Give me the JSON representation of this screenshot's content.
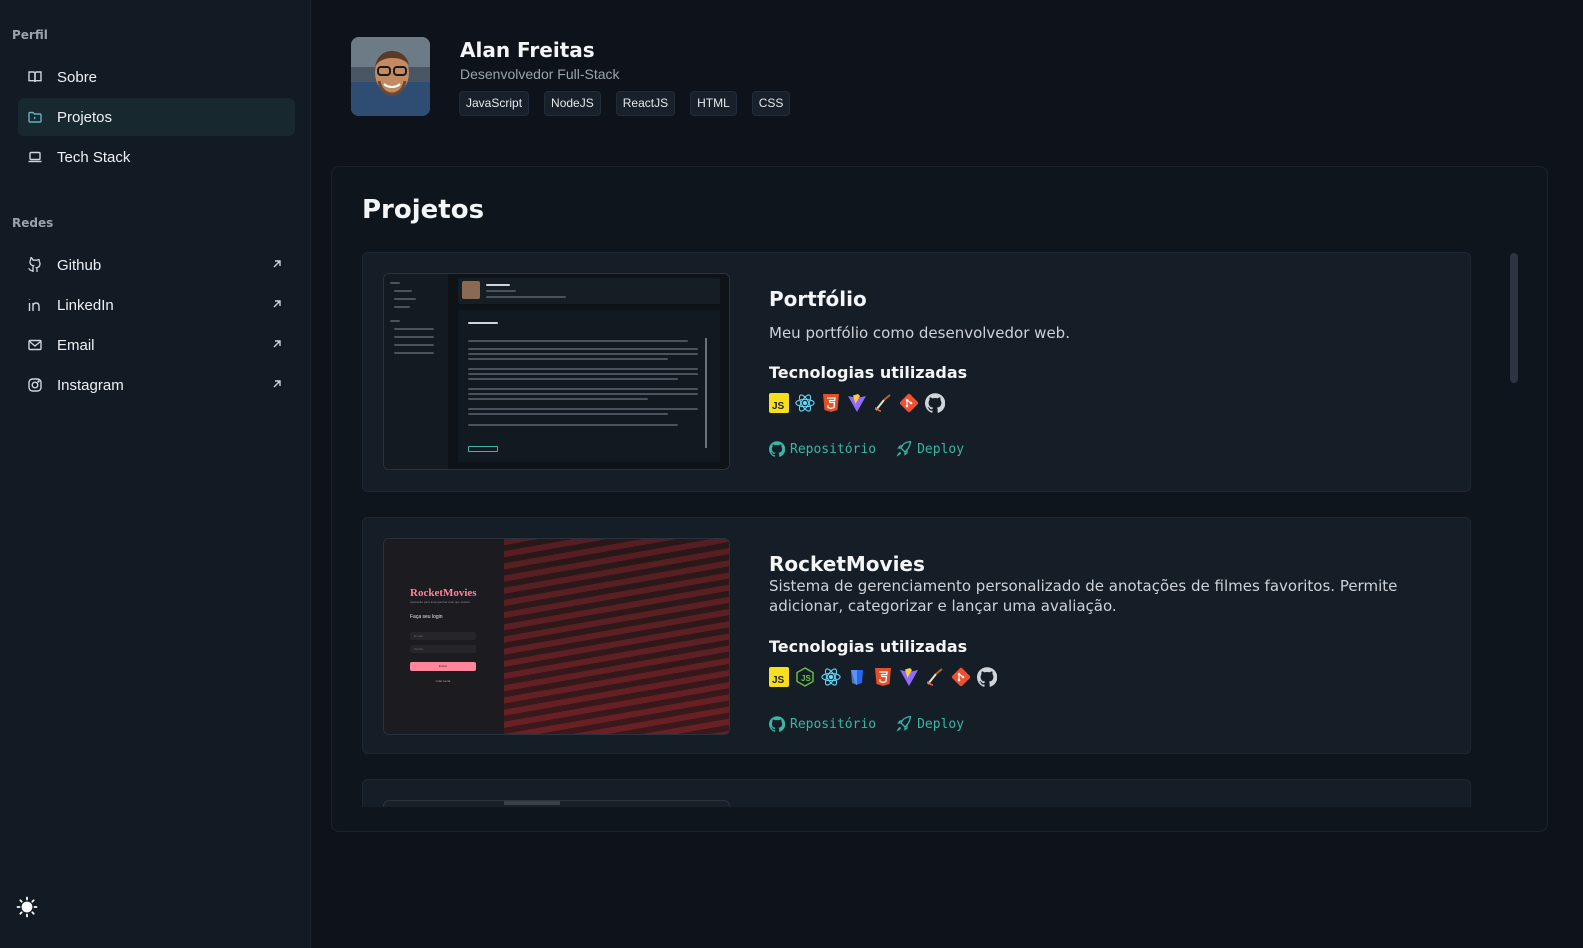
{
  "sidebar": {
    "profile_section": "Perfil",
    "nav": [
      {
        "label": "Sobre",
        "icon": "book-icon"
      },
      {
        "label": "Projetos",
        "icon": "folder-icon",
        "active": true
      },
      {
        "label": "Tech Stack",
        "icon": "laptop-icon"
      }
    ],
    "networks_section": "Redes",
    "networks": [
      {
        "label": "Github",
        "icon": "github-icon"
      },
      {
        "label": "LinkedIn",
        "icon": "linkedin-icon"
      },
      {
        "label": "Email",
        "icon": "mail-icon"
      },
      {
        "label": "Instagram",
        "icon": "instagram-icon"
      }
    ],
    "theme_icon": "sun-icon"
  },
  "header": {
    "name": "Alan Freitas",
    "role": "Desenvolvedor Full-Stack",
    "tags": [
      "JavaScript",
      "NodeJS",
      "ReactJS",
      "HTML",
      "CSS"
    ]
  },
  "main": {
    "title": "Projetos",
    "tech_heading": "Tecnologias utilizadas",
    "repo_label": "Repositório",
    "deploy_label": "Deploy",
    "projects": [
      {
        "title": "Portfólio",
        "description": "Meu portfólio como desenvolvedor web.",
        "techs": [
          "javascript",
          "react",
          "html5",
          "vite",
          "tailwind",
          "git",
          "github"
        ]
      },
      {
        "title": "RocketMovies",
        "description": "Sistema de gerenciamento personalizado de anotações de filmes favoritos. Permite adicionar, categorizar e lançar uma avaliação.",
        "techs": [
          "javascript",
          "nodejs",
          "react",
          "css3",
          "html5",
          "vite",
          "tailwind",
          "git",
          "github"
        ],
        "thumb": {
          "brand": "RocketMovies",
          "subtitle": "Aplicação para acompanhar tudo que assistir.",
          "login_title": "Faça seu login",
          "email_placeholder": "E-mail",
          "password_placeholder": "Senha",
          "button": "Entrar",
          "link": "Criar conta"
        }
      }
    ]
  },
  "colors": {
    "background": "#0e131b",
    "sidebar": "#121a24",
    "accent": "#39b6a4",
    "active_nav": "#17282f"
  }
}
